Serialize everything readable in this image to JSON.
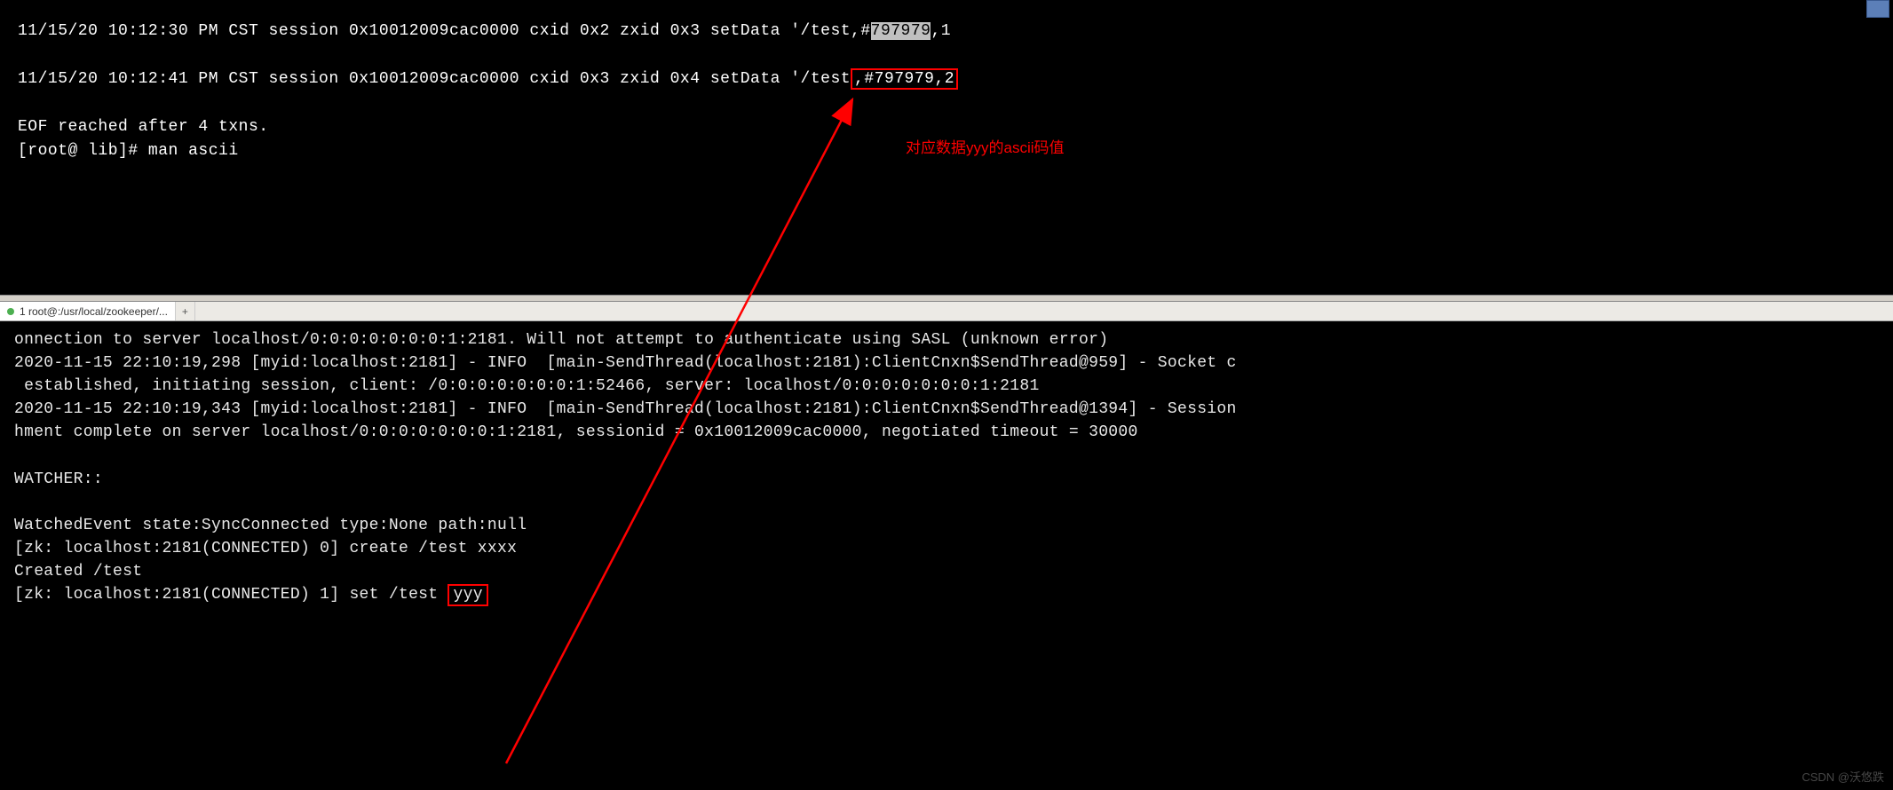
{
  "top_terminal": {
    "line1_prefix": "11/15/20 10:12:30 PM CST session 0x10012009cac0000 cxid 0x2 zxid 0x3 setData '/test,#",
    "line1_highlight": "797979",
    "line1_suffix": ",1",
    "line2_prefix": "11/15/20 10:12:41 PM CST session 0x10012009cac0000 cxid 0x3 zxid 0x4 setData '/test",
    "line2_boxed": ",#797979,2",
    "line3": "EOF reached after 4 txns.",
    "line4": "[root@ lib]# man ascii"
  },
  "tab": {
    "title": "1 root@:/usr/local/zookeeper/...",
    "add_label": "+"
  },
  "bottom_terminal": {
    "l1": "onnection to server localhost/0:0:0:0:0:0:0:1:2181. Will not attempt to authenticate using SASL (unknown error)",
    "l2": "2020-11-15 22:10:19,298 [myid:localhost:2181] - INFO  [main-SendThread(localhost:2181):ClientCnxn$SendThread@959] - Socket c",
    "l3": " established, initiating session, client: /0:0:0:0:0:0:0:1:52466, server: localhost/0:0:0:0:0:0:0:1:2181",
    "l4": "2020-11-15 22:10:19,343 [myid:localhost:2181] - INFO  [main-SendThread(localhost:2181):ClientCnxn$SendThread@1394] - Session",
    "l5": "hment complete on server localhost/0:0:0:0:0:0:0:1:2181, sessionid = 0x10012009cac0000, negotiated timeout = 30000",
    "l6": "",
    "l7": "WATCHER::",
    "l8": "",
    "l9": "WatchedEvent state:SyncConnected type:None path:null",
    "l10": "[zk: localhost:2181(CONNECTED) 0] create /test xxxx",
    "l11": "Created /test",
    "l12_prefix": "[zk: localhost:2181(CONNECTED) 1] set /test ",
    "l12_boxed": "yyy"
  },
  "annotation": {
    "text": "对应数据yyy的ascii码值"
  },
  "watermark": "CSDN @沃悠跌"
}
